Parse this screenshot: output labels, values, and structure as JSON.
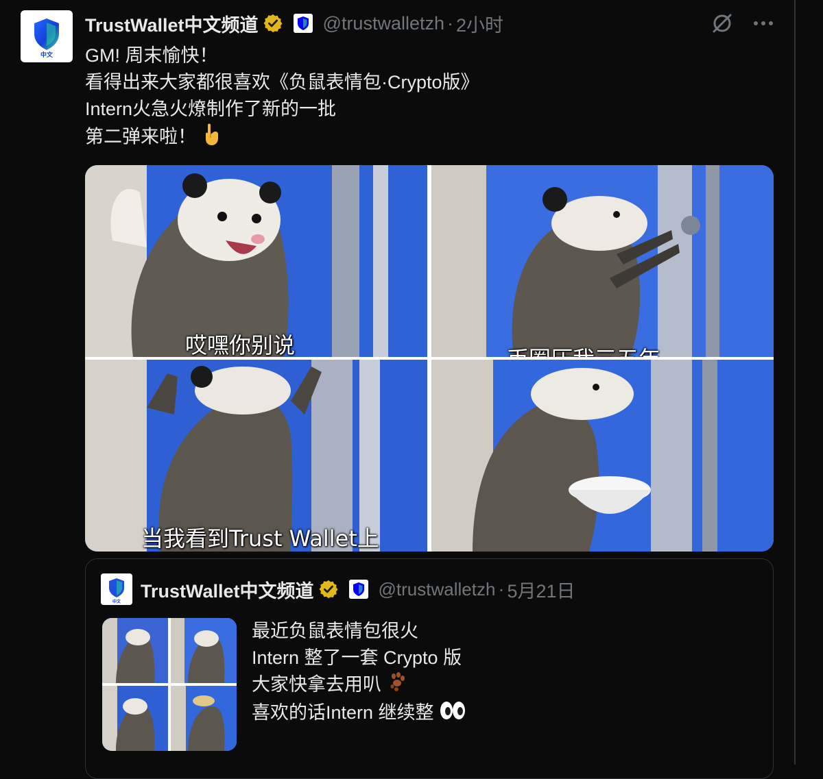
{
  "tweet": {
    "avatar_label": "中文",
    "display_name": "TrustWallet中文频道",
    "handle": "@trustwalletzh",
    "separator": "·",
    "time": "2小时",
    "icons": [
      "verified-badge-icon",
      "trustwallet-affiliate-icon",
      "grok-icon",
      "more-icon"
    ],
    "lines": [
      "GM! 周末愉快！",
      "看得出来大家都很喜欢《负鼠表情包·Crypto版》",
      "Intern火急火燎制作了新的一批",
      "第二弹来啦！"
    ],
    "line4_emoji": "point-down-emoji"
  },
  "media": {
    "captions": [
      "哎嘿你别说",
      "币圈压我三五年",
      "当我看到Trust Wallet上",
      ""
    ]
  },
  "quote": {
    "avatar_label": "中文",
    "display_name": "TrustWallet中文频道",
    "handle": "@trustwalletzh",
    "separator": "·",
    "date": "5月21日",
    "lines": [
      "最近负鼠表情包很火",
      "Intern 整了一套 Crypto 版",
      "大家快拿去用叭",
      "喜欢的话Intern 继续整"
    ],
    "line3_emoji": "paw-prints-emoji",
    "line4_emoji": "eyes-emoji"
  },
  "colors": {
    "background": "#0b0b0c",
    "text": "#e7e9ea",
    "muted": "#71767b",
    "border": "#2f3336",
    "verified_gold": "#e2b719",
    "brand_blue": "#0500ff"
  }
}
